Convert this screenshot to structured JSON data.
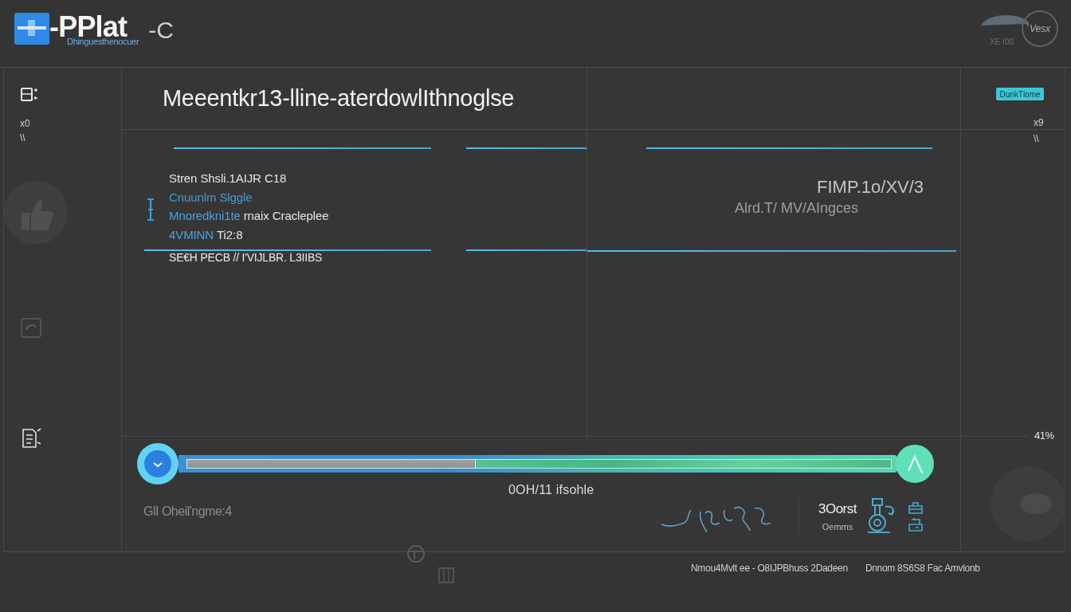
{
  "header": {
    "brand": "-PPlat",
    "tagline": "Dhinguesthenocuer",
    "brand_suffix": "-C",
    "status_text": "XE I00",
    "round_button": "Vesx"
  },
  "panel": {
    "title": "Meeentkr13-lline-aterdowlIthnoglse",
    "action_button": "DunkTlome",
    "left_scale": {
      "top": "x0",
      "bottom": "\\\\"
    },
    "right_scale": {
      "top": "x9",
      "bottom": "\\\\"
    },
    "details": [
      {
        "kind": "plain",
        "text": "Stren Shsli.1AIJR C18"
      },
      {
        "kind": "accent",
        "text": "Cnuunlm Slggle"
      },
      {
        "kind": "mixed",
        "lead": "Mnoredkni1te",
        "text": "rnaix Cracleplee"
      },
      {
        "kind": "mixed",
        "lead": "4VMINN",
        "text": "Ti2:8"
      }
    ],
    "detail_footer": "SE€H PECB // I'VIJLBR. L3IIBS",
    "summary": {
      "code": "FIMP.1o/XV/3",
      "subtitle": "Alrd.T/ MV/AIngces"
    },
    "progress": {
      "level": 0.41,
      "reading": "41%",
      "caption": "0OH/11 ifsohle"
    },
    "note": "GlI Oheil'ngme:4",
    "stat": {
      "value": "3Oorst",
      "label": "Oemms"
    }
  },
  "footer": {
    "texts": [
      "Nmou4Mvlt ee - O8IJPBhuss 2Dadeen",
      "Dnnom 8S6S8 Fac Amvlonb"
    ]
  }
}
